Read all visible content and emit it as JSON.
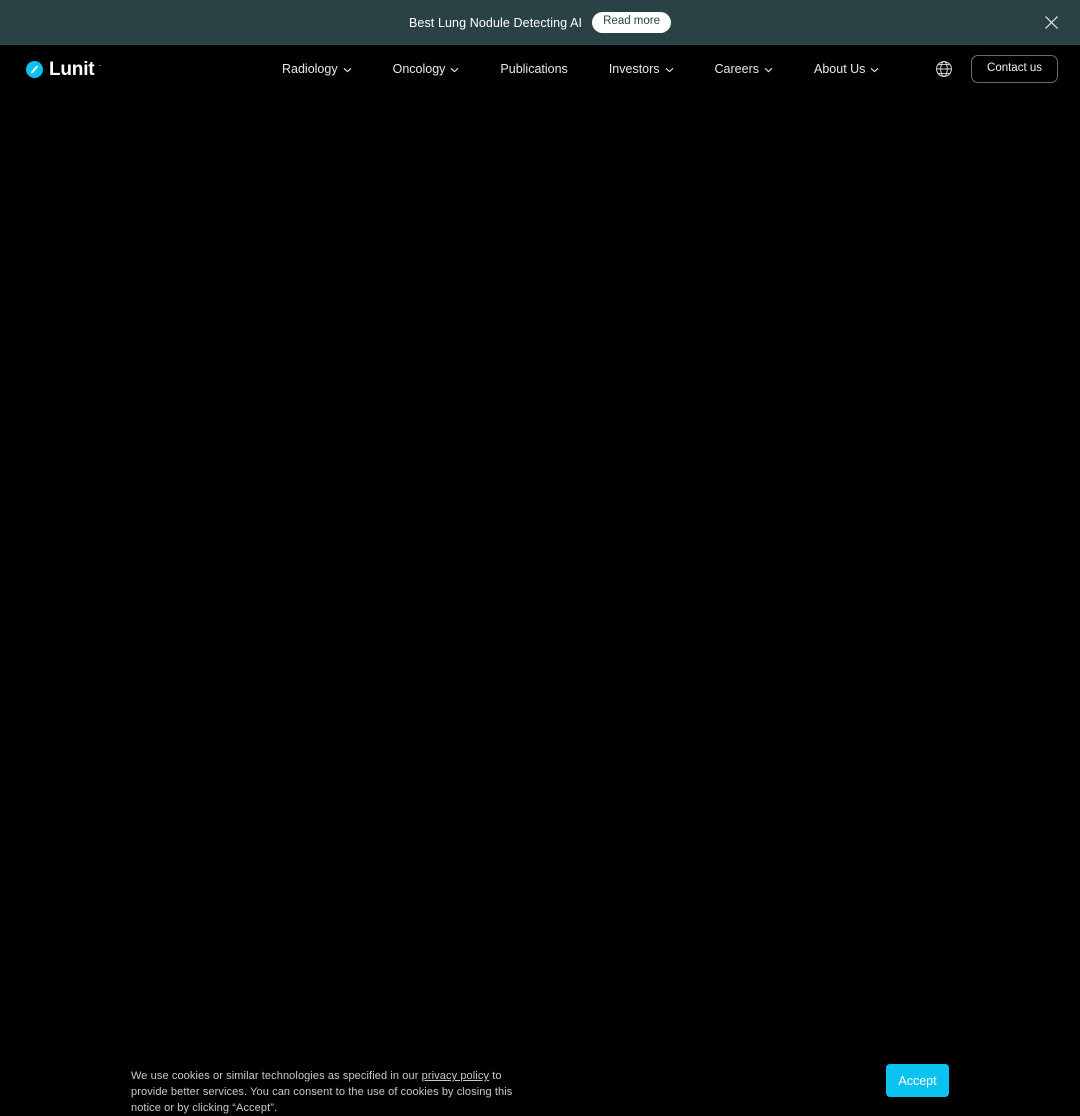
{
  "promo_banner": {
    "message": "Best Lung Nodule Detecting AI",
    "cta_label": "Read more",
    "close_icon": "close-icon",
    "background_color": "#2a4146"
  },
  "header": {
    "logo": {
      "wordmark": "Lunit",
      "superscript": "·",
      "mark_icon": "lunit-circle-slash-icon",
      "mark_color": "#0ac3f0"
    },
    "nav_items": [
      {
        "label": "Radiology",
        "has_dropdown": true,
        "caret_icon": "chevron-down-icon"
      },
      {
        "label": "Oncology",
        "has_dropdown": true,
        "caret_icon": "chevron-down-icon"
      },
      {
        "label": "Publications",
        "has_dropdown": false
      },
      {
        "label": "Investors",
        "has_dropdown": true,
        "caret_icon": "chevron-down-icon"
      },
      {
        "label": "Careers",
        "has_dropdown": true,
        "caret_icon": "chevron-down-icon"
      },
      {
        "label": "About Us",
        "has_dropdown": true,
        "caret_icon": "chevron-down-icon"
      }
    ],
    "language_icon": "globe-icon",
    "contact_label": "Contact us"
  },
  "cookie_notice": {
    "text_before_link": "We use cookies or similar technologies as specified in our ",
    "link_label": "privacy policy",
    "text_after_link": " to provide better services. You can consent to the use of cookies by closing this notice or by clicking “Accept”.",
    "accept_label": "Accept",
    "accept_color": "#0ac3f0"
  },
  "page": {
    "background_color": "#000000"
  }
}
